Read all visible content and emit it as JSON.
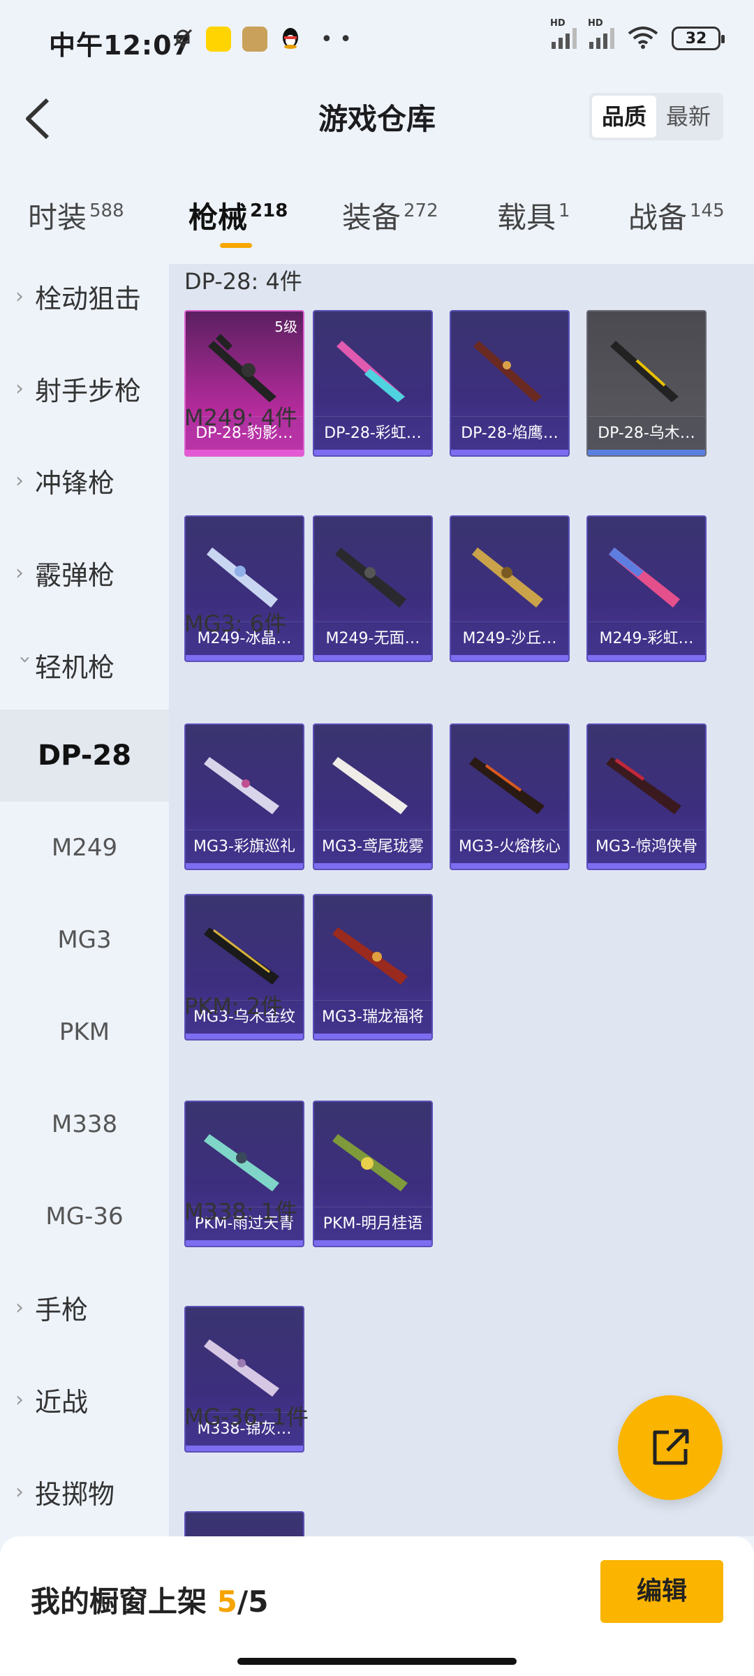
{
  "status": {
    "time": "中午12:07",
    "signal_label_1": "HD",
    "signal_label_2": "HD",
    "battery": "32"
  },
  "header": {
    "title": "游戏仓库",
    "sort_quality": "品质",
    "sort_latest": "最新"
  },
  "tabs": [
    {
      "label": "时装",
      "count": "588"
    },
    {
      "label": "枪械",
      "count": "218"
    },
    {
      "label": "装备",
      "count": "272"
    },
    {
      "label": "载具",
      "count": "1"
    },
    {
      "label": "战备",
      "count": "145"
    }
  ],
  "sidebar": {
    "categories": [
      "栓动狙击",
      "射手步枪",
      "冲锋枪",
      "霰弹枪",
      "轻机枪",
      "手枪",
      "近战",
      "投掷物"
    ],
    "subitems": [
      "DP-28",
      "M249",
      "MG3",
      "PKM",
      "M338",
      "MG-36"
    ]
  },
  "sections": [
    {
      "title": "DP-28: 4件",
      "items": [
        "DP-28-豹影…",
        "DP-28-彩虹…",
        "DP-28-焰鹰…",
        "DP-28-乌木…"
      ]
    },
    {
      "title": "M249: 4件",
      "items": [
        "M249-冰晶…",
        "M249-无面…",
        "M249-沙丘…",
        "M249-彩虹…"
      ]
    },
    {
      "title": "MG3: 6件",
      "items": [
        "MG3-彩旗巡礼",
        "MG3-鸢尾珑雾",
        "MG3-火熔核心",
        "MG3-惊鸿侠骨",
        "MG3-乌木金纹",
        "MG3-瑞龙福将"
      ]
    },
    {
      "title": "PKM: 2件",
      "items": [
        "PKM-雨过天青",
        "PKM-明月桂语"
      ]
    },
    {
      "title": "M338: 1件",
      "items": [
        "M338-锦灰…"
      ]
    },
    {
      "title": "MG-36: 1件",
      "items": [
        ""
      ]
    }
  ],
  "level_badge": "5级",
  "bottom": {
    "label": "我的橱窗上架 ",
    "current": "5",
    "total": "/5",
    "edit": "编辑"
  },
  "colors": {
    "accent": "#fbb400",
    "card_purple": "#3d2e7e",
    "card_pink": "#d63ab6"
  }
}
